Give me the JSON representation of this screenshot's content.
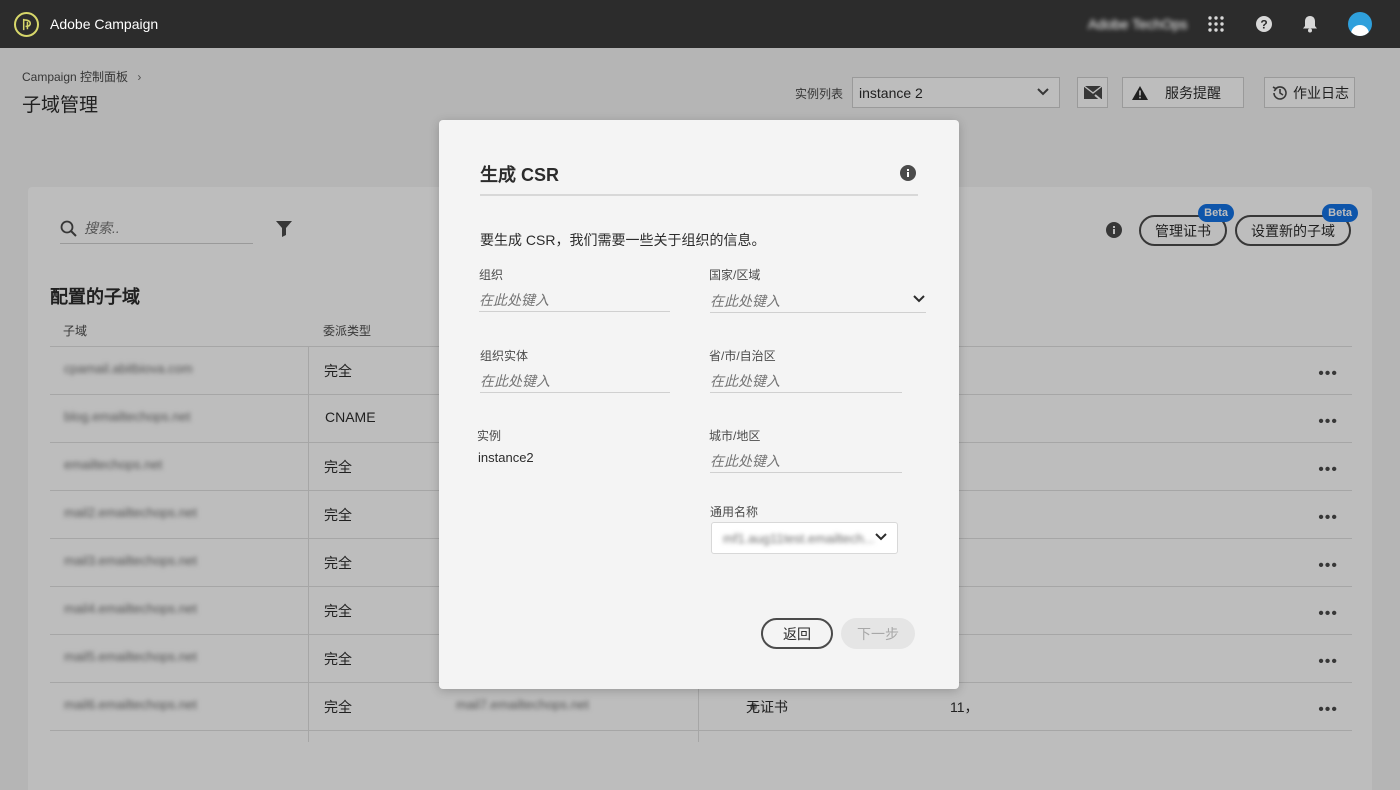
{
  "app": {
    "title": "Adobe Campaign",
    "org_name": "Adobe TechOps",
    "icons": [
      "adobe-campaign-logo",
      "apps-grid-icon",
      "help-icon",
      "bell-icon",
      "avatar"
    ]
  },
  "header": {
    "breadcrumb": "Campaign 控制面板",
    "page_title": "子域管理",
    "instance_label": "实例列表",
    "instance_value": "instance 2",
    "alert_button": "服务提醒",
    "log_button": "作业日志"
  },
  "main": {
    "search_placeholder": "搜索..",
    "manage_cert_button": "管理证书",
    "new_subdomain_button": "设置新的子域",
    "beta_badge": "Beta",
    "section_title": "配置的子域",
    "columns": [
      "子域",
      "委派类型"
    ],
    "rows": [
      {
        "subdomain": "cpamail.abitbiova.com",
        "delegation": "完全"
      },
      {
        "subdomain": "blog.emailtechops.net",
        "delegation": "CNAME"
      },
      {
        "subdomain": "emailtechops.net",
        "delegation": "完全"
      },
      {
        "subdomain": "mail2.emailtechops.net",
        "delegation": "完全"
      },
      {
        "subdomain": "mail3.emailtechops.net",
        "delegation": "完全"
      },
      {
        "subdomain": "mail4.emailtechops.net",
        "delegation": "完全"
      },
      {
        "subdomain": "mail5.emailtechops.net",
        "delegation": "完全"
      },
      {
        "subdomain": "mail6.emailtechops.net",
        "delegation": "完全",
        "col3": "mail7.emailtechops.net",
        "status": "无证书",
        "count": "11，"
      }
    ]
  },
  "modal": {
    "title": "生成 CSR",
    "description": "要生成 CSR，我们需要一些关于组织的信息。",
    "org_label": "组织",
    "org_placeholder": "在此处键入",
    "country_label": "国家/区域",
    "country_placeholder": "在此处键入",
    "org_unit_label": "组织实体",
    "org_unit_placeholder": "在此处键入",
    "state_label": "省/市/自治区",
    "state_placeholder": "在此处键入",
    "instance_label": "实例",
    "instance_value": "instance2",
    "city_label": "城市/地区",
    "city_placeholder": "在此处键入",
    "common_name_label": "通用名称",
    "common_name_value": "mf1.aug11test.emailtech...",
    "back_button": "返回",
    "next_button": "下一步"
  }
}
